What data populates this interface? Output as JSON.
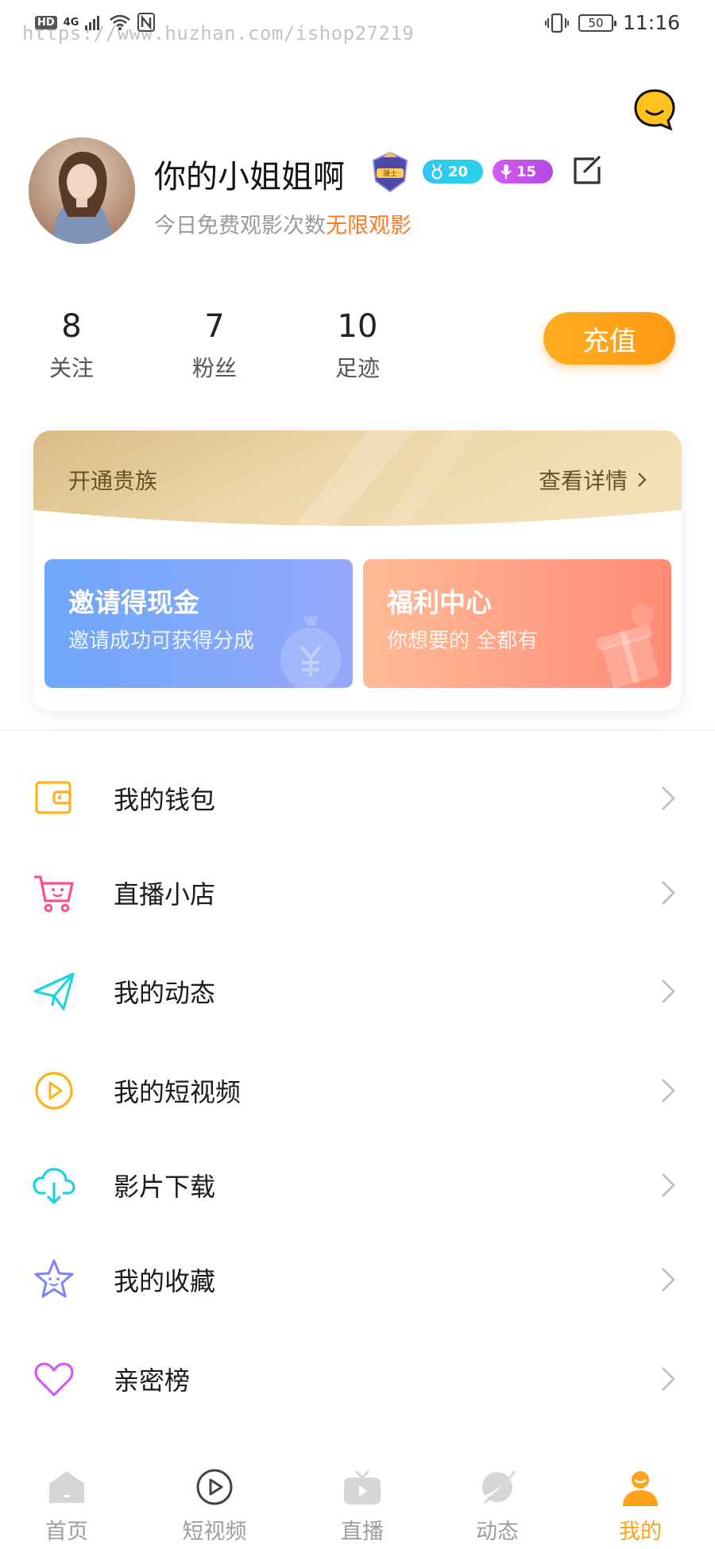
{
  "status_bar": {
    "network": "HD",
    "signal": "4G",
    "watermark": "https://www.huzhan.com/ishop27219",
    "battery": "50",
    "time": "11:16"
  },
  "profile": {
    "nickname": "你的小姐姐啊",
    "rank_badge_text": "骑士",
    "medal_count": "20",
    "mic_count": "15",
    "subtitle_prefix": "今日免费观影次数",
    "subtitle_highlight": "无限观影"
  },
  "stats": [
    {
      "value": "8",
      "label": "关注"
    },
    {
      "value": "7",
      "label": "粉丝"
    },
    {
      "value": "10",
      "label": "足迹"
    }
  ],
  "recharge_label": "充值",
  "vip": {
    "title": "开通贵族",
    "more": "查看详情"
  },
  "promos": [
    {
      "title": "邀请得现金",
      "subtitle": "邀请成功可获得分成"
    },
    {
      "title": "福利中心",
      "subtitle": "你想要的 全都有"
    }
  ],
  "menu": [
    {
      "label": "我的钱包",
      "icon": "wallet-icon"
    },
    {
      "label": "直播小店",
      "icon": "cart-icon"
    },
    {
      "label": "我的动态",
      "icon": "paper-plane-icon"
    },
    {
      "label": "我的短视频",
      "icon": "play-circle-icon"
    },
    {
      "label": "影片下载",
      "icon": "cloud-download-icon"
    },
    {
      "label": "我的收藏",
      "icon": "star-icon"
    },
    {
      "label": "亲密榜",
      "icon": "heart-icon"
    }
  ],
  "tabs": [
    {
      "label": "首页",
      "icon": "home-icon"
    },
    {
      "label": "短视频",
      "icon": "play-icon"
    },
    {
      "label": "直播",
      "icon": "tv-icon"
    },
    {
      "label": "动态",
      "icon": "planet-icon"
    },
    {
      "label": "我的",
      "icon": "user-icon",
      "active": true
    }
  ],
  "colors": {
    "accent": "#ffa21a",
    "highlight": "#ff7a1f",
    "invite_card": "#6ea7fb",
    "welfare_card": "#ff8a76",
    "tab_inactive": "#9d9d9d"
  }
}
